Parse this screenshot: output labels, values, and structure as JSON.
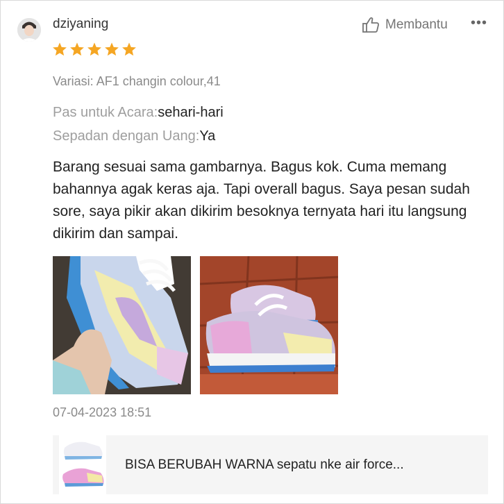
{
  "review": {
    "username": "dziyaning",
    "rating": 5,
    "helpful_label": "Membantu",
    "more_label": "•••",
    "variation": "Variasi: AF1 changin colour,41",
    "attributes": [
      {
        "key": "Pas untuk Acara:",
        "value": "sehari-hari"
      },
      {
        "key": "Sepadan dengan Uang:",
        "value": "Ya"
      }
    ],
    "text": "Barang sesuai sama gambarnya. Bagus kok. Cuma memang bahannya agak keras aja. Tapi overall bagus. Saya pesan sudah sore, saya pikir akan dikirim besoknya ternyata hari itu langsung dikirim dan sampai.",
    "timestamp": "07-04-2023 18:51"
  },
  "icons": {
    "avatar": "avatar-photo",
    "helpful": "thumbs-up-icon",
    "star": "star-icon",
    "star_color": "#f5a623"
  },
  "product": {
    "name": "BISA BERUBAH WARNA sepatu nke air force..."
  }
}
